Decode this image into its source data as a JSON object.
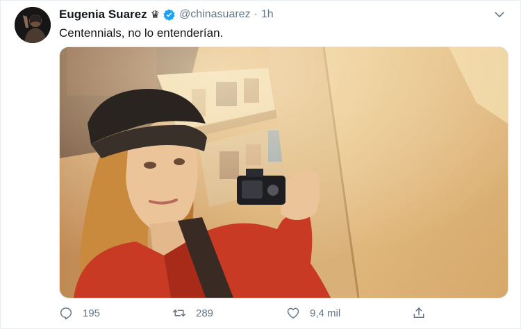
{
  "tweet": {
    "display_name": "Eugenia Suarez",
    "name_emoji": "♛",
    "verified_icon": "verified-badge-icon",
    "handle": "@chinasuarez",
    "separator": "·",
    "time": "1h",
    "text": "Centennials, no lo entenderían."
  },
  "actions": {
    "reply_count": "195",
    "retweet_count": "289",
    "like_count": "9,4 mil"
  },
  "colors": {
    "accent": "#1da1f2",
    "secondary_text": "#657786",
    "primary_text": "#14171a"
  }
}
